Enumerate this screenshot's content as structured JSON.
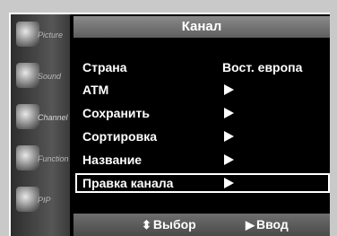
{
  "title": "Канал",
  "sidebar": [
    {
      "label": "Picture",
      "icon": "picture-icon"
    },
    {
      "label": "Sound",
      "icon": "sound-icon"
    },
    {
      "label": "Channel",
      "icon": "channel-icon"
    },
    {
      "label": "Function",
      "icon": "function-icon"
    },
    {
      "label": "PIP",
      "icon": "pip-icon"
    }
  ],
  "menu": [
    {
      "name": "Страна",
      "value": "Вост. европа"
    },
    {
      "name": "ATM"
    },
    {
      "name": "Сохранить"
    },
    {
      "name": "Сортировка"
    },
    {
      "name": "Название"
    },
    {
      "name": "Правка канала",
      "selected": true
    }
  ],
  "footer": {
    "select_glyph": "⬍",
    "select_label": "Выбор",
    "enter_glyph": "▶",
    "enter_label": "Ввод"
  }
}
